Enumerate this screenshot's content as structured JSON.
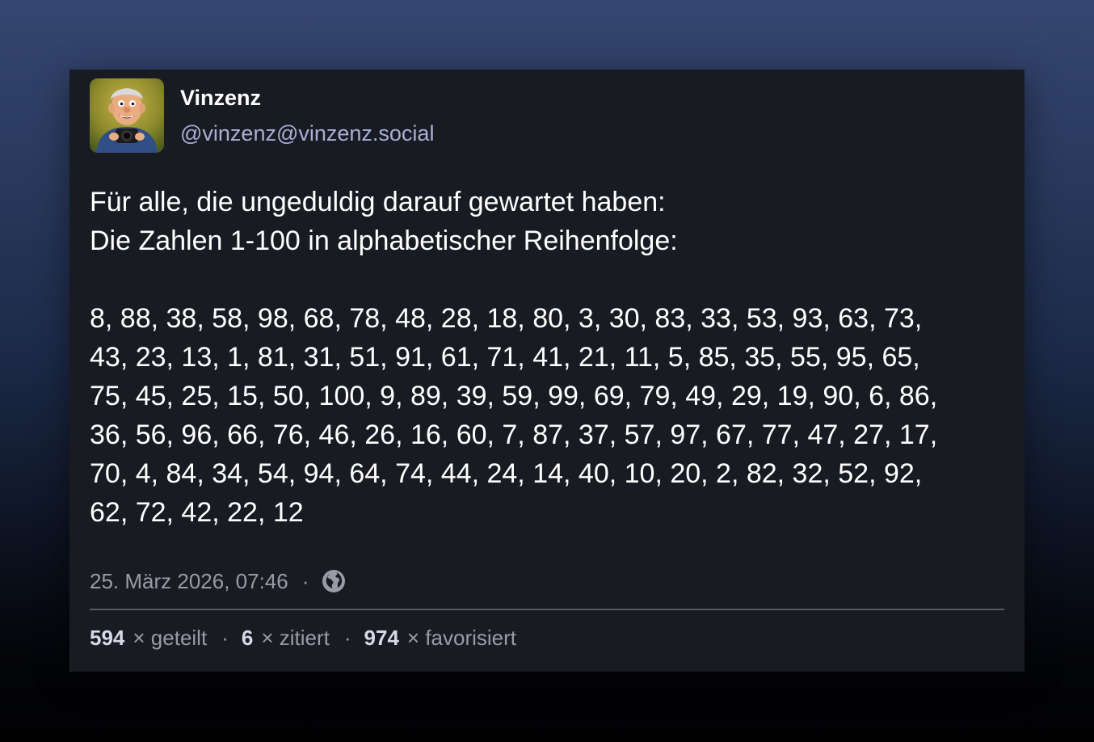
{
  "post": {
    "author": {
      "display_name": "Vinzenz",
      "handle": "@vinzenz@vinzenz.social",
      "avatar_icon": "clay-man-with-camera-avatar"
    },
    "content": {
      "line1": "Für alle, die ungeduldig darauf gewartet haben:",
      "line2": "Die Zahlen 1-100 in alphabetischer Reihenfolge:",
      "numbers": [
        "8, 88, 38, 58, 98, 68, 78, 48, 28, 18, 80, 3, 30, 83, 33, 53, 93, 63, 73,",
        "43, 23, 13, 1, 81, 31, 51, 91, 61, 71, 41, 21, 11, 5, 85, 35, 55, 95, 65,",
        "75, 45, 25, 15, 50, 100, 9, 89, 39, 59, 99, 69, 79, 49, 29, 19, 90, 6, 86,",
        "36, 56, 96, 66, 76, 46, 26, 16, 60, 7, 87, 37, 57, 97, 67, 77, 47, 27, 17,",
        "70, 4, 84, 34, 54, 94, 64, 74, 44, 24, 14, 40, 10, 20, 2, 82, 32, 52, 92,",
        "62, 72, 42, 22, 12"
      ]
    },
    "timestamp": "25. März 2026, 07:46",
    "separator": "·",
    "visibility_icon": "globe-icon",
    "stats": {
      "reblogs_count": "594",
      "reblogs_label": "× geteilt",
      "quotes_count": "6",
      "quotes_label": "× zitiert",
      "favourites_count": "974",
      "favourites_label": "× favorisiert"
    }
  },
  "colors": {
    "card_background": "#191b22",
    "handle": "#a7b0d6",
    "meta_text": "#9a9ba7",
    "stat_number": "#d6dae8"
  }
}
